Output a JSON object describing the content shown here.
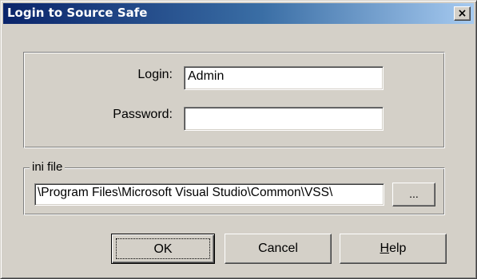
{
  "window": {
    "title": "Login to Source Safe",
    "close_label": "✕"
  },
  "login_group": {
    "login_label": "Login:",
    "login_value": "Admin",
    "password_label": "Password:",
    "password_value": ""
  },
  "ini_group": {
    "legend": "ini file",
    "path_value": "\\Program Files\\Microsoft Visual Studio\\Common\\VSS\\",
    "browse_label": "..."
  },
  "buttons": {
    "ok_label": "OK",
    "cancel_label": "Cancel",
    "help_mnemonic": "H",
    "help_rest": "elp"
  },
  "colors": {
    "face": "#d4d0c8",
    "title_start": "#0a246a",
    "title_end": "#a6caf0"
  }
}
